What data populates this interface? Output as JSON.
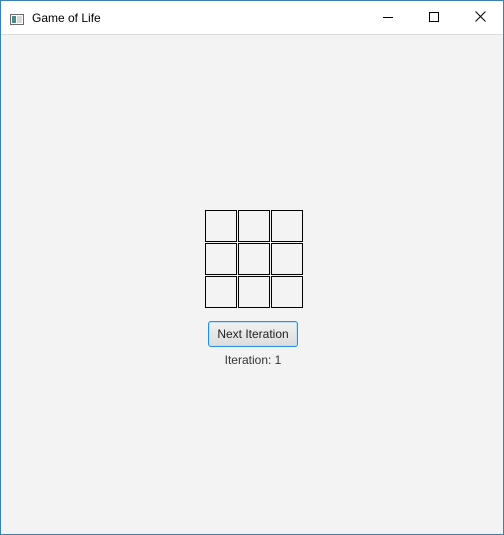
{
  "window": {
    "title": "Game of Life",
    "app_icon": "java-app-icon",
    "controls": [
      "minimize-icon",
      "maximize-icon",
      "close-icon"
    ]
  },
  "board": {
    "rows": 3,
    "cols": 3,
    "cells": [
      [
        0,
        0,
        0
      ],
      [
        0,
        0,
        0
      ],
      [
        0,
        0,
        0
      ]
    ]
  },
  "controls": {
    "next_label": "Next Iteration"
  },
  "status": {
    "iteration_text": "Iteration: 1"
  },
  "colors": {
    "background": "#f3f3f3",
    "cell_border": "#000000",
    "button_focus": "#2a8ee0"
  }
}
